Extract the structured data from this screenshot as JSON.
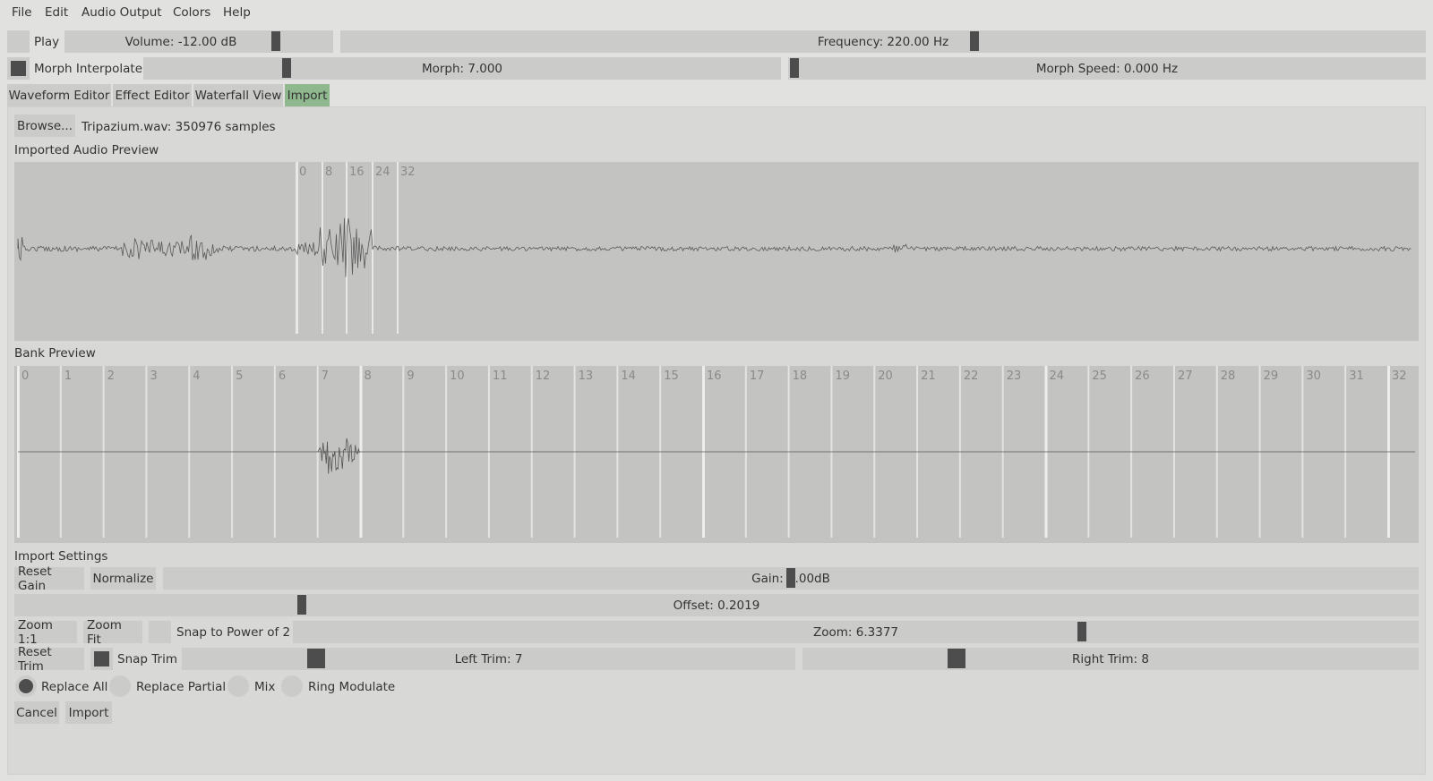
{
  "menu": [
    "File",
    "Edit",
    "Audio Output",
    "Colors",
    "Help"
  ],
  "top": {
    "play_label": "Play",
    "volume_label": "Volume: -12.00 dB",
    "volume_level": 0.78,
    "frequency_label": "Frequency: 220.00 Hz",
    "frequency_level": 0.59,
    "morph_interpolate_label": "Morph Interpolate",
    "morph_label": "Morph: 7.000",
    "morph_level": 0.22,
    "morph_speed_label": "Morph Speed: 0.000 Hz",
    "morph_speed_level": 0.0
  },
  "tabs": [
    "Waveform Editor",
    "Effect Editor",
    "Waterfall View",
    "Import"
  ],
  "active_tab": "Import",
  "import": {
    "browse_label": "Browse...",
    "file_info": "Tripazium.wav: 350976 samples",
    "preview_title": "Imported Audio Preview",
    "preview_ticks": [
      "0",
      "8",
      "16",
      "24",
      "32"
    ],
    "bank_title": "Bank Preview",
    "bank_ticks": [
      "0",
      "1",
      "2",
      "3",
      "4",
      "5",
      "6",
      "7",
      "8",
      "9",
      "10",
      "11",
      "12",
      "13",
      "14",
      "15",
      "16",
      "17",
      "18",
      "19",
      "20",
      "21",
      "22",
      "23",
      "24",
      "25",
      "26",
      "27",
      "28",
      "29",
      "30",
      "31",
      "32"
    ],
    "settings_title": "Import Settings",
    "reset_gain_label": "Reset Gain",
    "normalize_label": "Normalize",
    "gain_label": "Gain: 0.00dB",
    "gain_level": 0.5,
    "offset_label": "Offset: 0.2019",
    "offset_level": 0.2019,
    "zoom_1_1_label": "Zoom 1:1",
    "zoom_fit_label": "Zoom Fit",
    "snap_power_label": "Snap to Power of 2",
    "zoom_label": "Zoom: 6.3377",
    "zoom_level": 0.72,
    "reset_trim_label": "Reset Trim",
    "snap_trim_label": "Snap Trim",
    "left_trim_label": "Left Trim: 7",
    "left_trim_level": 0.22,
    "right_trim_label": "Right Trim: 8",
    "right_trim_level": 0.25,
    "modes": [
      "Replace All",
      "Replace Partial",
      "Mix",
      "Ring Modulate"
    ],
    "selected_mode": "Replace All",
    "cancel_label": "Cancel",
    "import_label": "Import"
  },
  "colors": {
    "background": "#e1e1e0",
    "slider": "#cbcbca",
    "handle": "#4d4d4d",
    "active_tab": "#8fb88f",
    "wave_bg": "#c3c3c2"
  }
}
